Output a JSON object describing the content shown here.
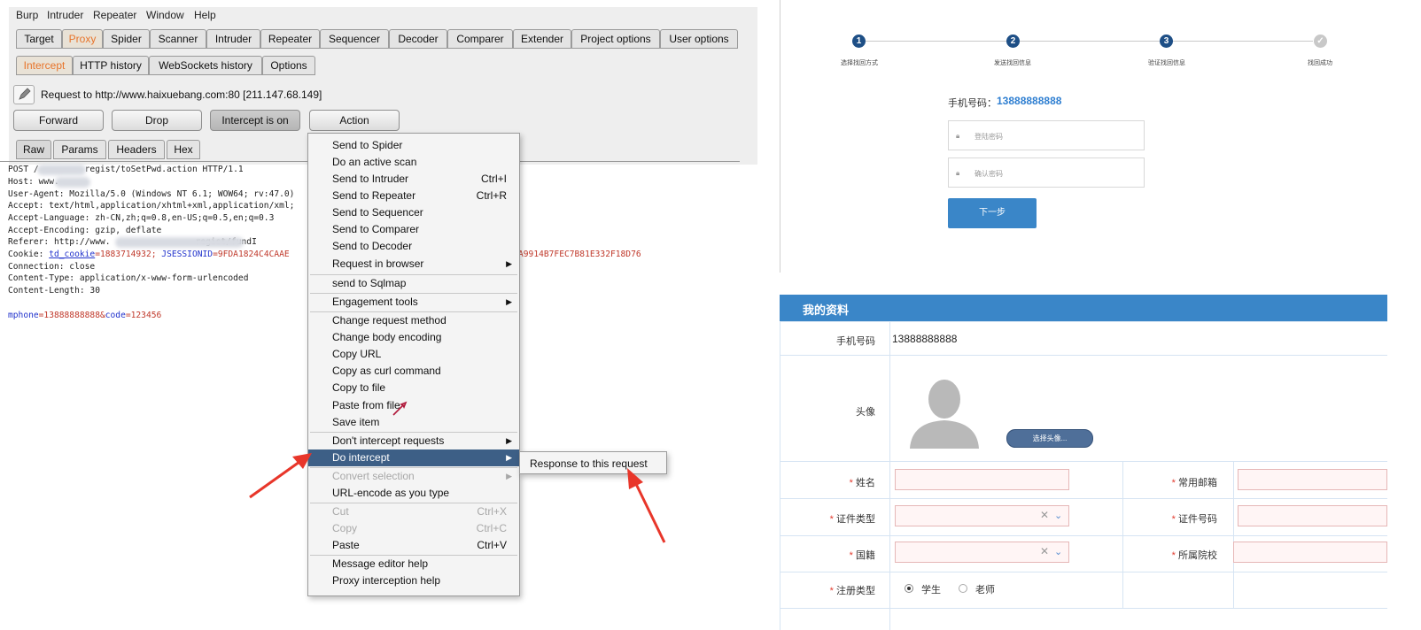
{
  "burp": {
    "menubar": [
      "Burp",
      "Intruder",
      "Repeater",
      "Window",
      "Help"
    ],
    "main_tabs": [
      "Target",
      "Proxy",
      "Spider",
      "Scanner",
      "Intruder",
      "Repeater",
      "Sequencer",
      "Decoder",
      "Comparer",
      "Extender",
      "Project options",
      "User options"
    ],
    "active_main_tab": "Proxy",
    "proxy_tabs": [
      "Intercept",
      "HTTP history",
      "WebSockets history",
      "Options"
    ],
    "request_to": "Request to http://www.haixuebang.com:80  [211.147.68.149]",
    "buttons": {
      "forward": "Forward",
      "drop": "Drop",
      "intercept": "Intercept is on",
      "action": "Action"
    },
    "editor_tabs": [
      "Raw",
      "Params",
      "Headers",
      "Hex"
    ],
    "request_lines": {
      "l1a": "POST /",
      "l1b": "regist/toSetPwd.action HTTP/1.1",
      "l2": "Host: www.",
      "l3": "User-Agent: Mozilla/5.0 (Windows NT 6.1; WOW64; rv:47.0)",
      "l4": "Accept: text/html,application/xhtml+xml,application/xml;",
      "l5": "Accept-Language: zh-CN,zh;q=0.8,en-US;q=0.5,en;q=0.3",
      "l6": "Accept-Encoding: gzip, deflate",
      "l7a": "Referer: http://www.",
      "l7b": "regist/fundI",
      "l8a": "Cookie: ",
      "l8b": "td_cookie",
      "l8c": "=1883714932; ",
      "l8d": "JSESSIONID",
      "l8e": "=9FDA1824C4CAAE",
      "l8f": "A9914B7FEC7B81E332F18D76",
      "l9": "Connection: close",
      "l10": "Content-Type: application/x-www-form-urlencoded",
      "l11": "Content-Length: 30",
      "body_a": "mphone",
      "body_b": "=13888888888&",
      "body_c": "code",
      "body_d": "=123456"
    },
    "context_menu": {
      "send_spider": "Send to Spider",
      "active_scan": "Do an active scan",
      "send_intruder": "Send to Intruder",
      "send_intruder_sc": "Ctrl+I",
      "send_repeater": "Send to Repeater",
      "send_repeater_sc": "Ctrl+R",
      "send_sequencer": "Send to Sequencer",
      "send_comparer": "Send to Comparer",
      "send_decoder": "Send to Decoder",
      "request_browser": "Request in browser",
      "sqlmap": "send to Sqlmap",
      "engagement": "Engagement tools",
      "change_method": "Change request method",
      "change_encoding": "Change body encoding",
      "copy_url": "Copy URL",
      "copy_curl": "Copy as curl command",
      "copy_file": "Copy to file",
      "paste_file": "Paste from file",
      "save_item": "Save item",
      "dont_intercept": "Don't intercept requests",
      "do_intercept": "Do intercept",
      "convert": "Convert selection",
      "url_encode": "URL-encode as you type",
      "cut": "Cut",
      "cut_sc": "Ctrl+X",
      "copy": "Copy",
      "copy_sc": "Ctrl+C",
      "paste": "Paste",
      "paste_sc": "Ctrl+V",
      "editor_help": "Message editor help",
      "proxy_help": "Proxy interception help"
    },
    "submenu_item": "Response to this request"
  },
  "reset_form": {
    "steps": [
      {
        "num": "1",
        "label": "选择找回方式"
      },
      {
        "num": "2",
        "label": "发送找回信息"
      },
      {
        "num": "3",
        "label": "验证找回信息"
      },
      {
        "num": "✓",
        "label": "找回成功"
      }
    ],
    "phone_label": "手机号码：",
    "phone_value": "13888888888",
    "new_pwd_placeholder": "登陆密码",
    "confirm_pwd_placeholder": "确认密码",
    "next_button": "下一步"
  },
  "profile": {
    "header": "我的资料",
    "phone_label": "手机号码",
    "phone_value": "13888888888",
    "avatar_label": "头像",
    "choose_avatar": "选择头像...",
    "name_label": "姓名",
    "email_label": "常用邮箱",
    "idtype_label": "证件类型",
    "idno_label": "证件号码",
    "nation_label": "国籍",
    "school_label": "所属院校",
    "regtype_label": "注册类型",
    "student": "学生",
    "teacher": "老师",
    "required_mark": "*"
  },
  "colors": {
    "accent_blue": "#3a86c8",
    "menu_selected": "#3d5f86",
    "arrow_red": "#e8362a"
  }
}
